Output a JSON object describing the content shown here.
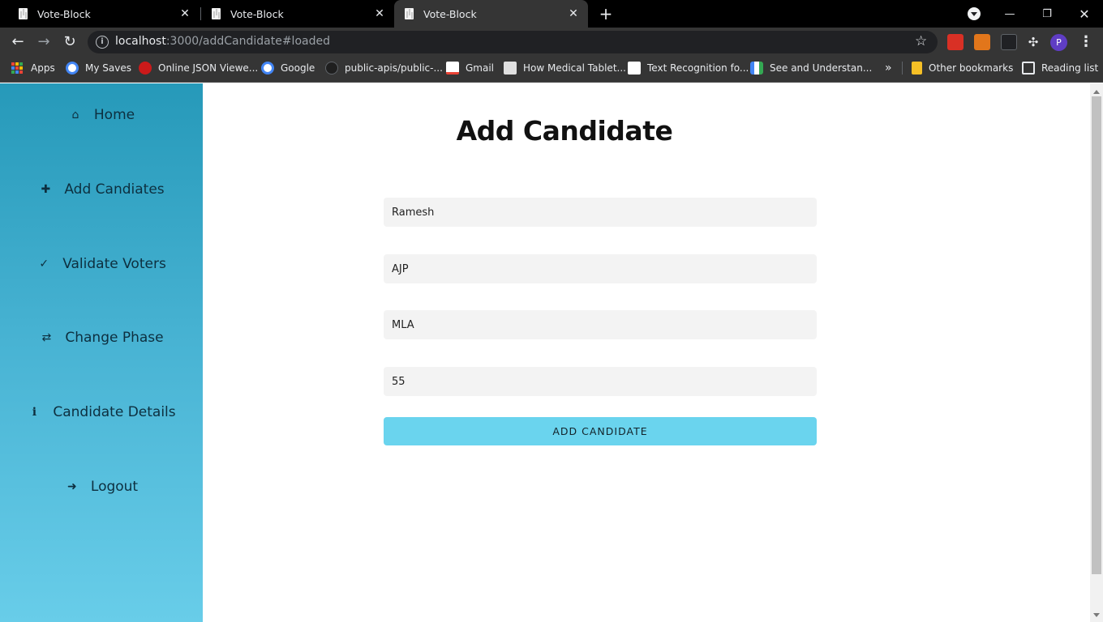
{
  "browser": {
    "tabs": [
      {
        "title": "Vote-Block",
        "active": false
      },
      {
        "title": "Vote-Block",
        "active": false
      },
      {
        "title": "Vote-Block",
        "active": true
      }
    ],
    "url_host": "localhost",
    "url_rest": ":3000/addCandidate#loaded",
    "profile_initial": "P",
    "bookmarks": [
      {
        "label": "Apps",
        "icon": "apps-grid-icon"
      },
      {
        "label": "My Saves",
        "icon": "google-icon"
      },
      {
        "label": "Online JSON Viewe...",
        "icon": "json-viewer-icon"
      },
      {
        "label": "Google",
        "icon": "google-icon"
      },
      {
        "label": "public-apis/public-...",
        "icon": "github-icon"
      },
      {
        "label": "Gmail",
        "icon": "gmail-icon"
      },
      {
        "label": "How Medical Tablet...",
        "icon": "site-icon"
      },
      {
        "label": "Text Recognition fo...",
        "icon": "medium-icon"
      },
      {
        "label": "See and Understan...",
        "icon": "google-cloud-icon"
      }
    ],
    "overflow_label": "»",
    "other_bookmarks": "Other bookmarks",
    "reading_list": "Reading list"
  },
  "sidebar": {
    "items": [
      {
        "label": "Home",
        "icon": "home-icon",
        "glyph": "⌂"
      },
      {
        "label": "Add Candiates",
        "icon": "user-plus-icon",
        "glyph": "👤"
      },
      {
        "label": "Validate Voters",
        "icon": "check-circle-icon",
        "glyph": "✓"
      },
      {
        "label": "Change Phase",
        "icon": "exchange-icon",
        "glyph": "⇄"
      },
      {
        "label": "Candidate Details",
        "icon": "info-icon",
        "glyph": "i"
      },
      {
        "label": "Logout",
        "icon": "sign-out-icon",
        "glyph": "➜"
      }
    ]
  },
  "main": {
    "title": "Add Candidate",
    "fields": [
      {
        "name": "candidate-name-field",
        "value": "Ramesh"
      },
      {
        "name": "candidate-party-field",
        "value": "AJP"
      },
      {
        "name": "candidate-position-field",
        "value": "MLA"
      },
      {
        "name": "candidate-age-field",
        "value": "55"
      }
    ],
    "submit_label": "ADD CANDIDATE"
  },
  "colors": {
    "sidebar_top": "#2699b9",
    "sidebar_bottom": "#68cde9",
    "button": "#6ad4ee",
    "field_bg": "#f3f3f3"
  }
}
